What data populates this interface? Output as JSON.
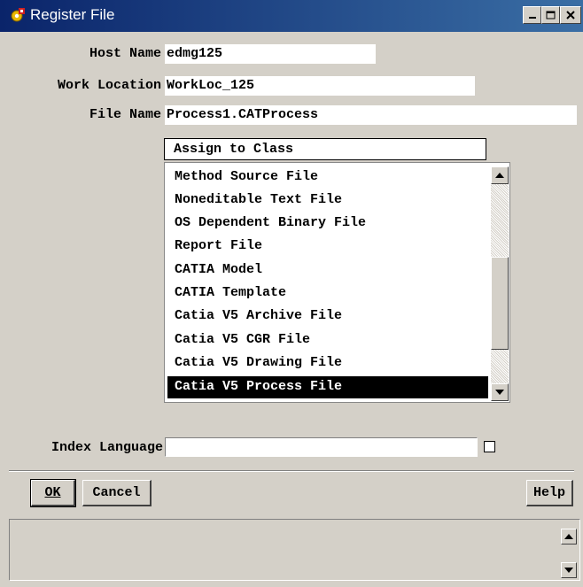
{
  "window": {
    "title": "Register File",
    "icon": "gear-app-icon",
    "controls": [
      "minimize-icon",
      "maximize-icon",
      "close-icon"
    ]
  },
  "form": {
    "host_name_label": "Host Name",
    "host_name_value": "edmg125",
    "work_location_label": "Work Location",
    "work_location_value": "WorkLoc_125",
    "file_name_label": "File Name",
    "file_name_value": "Process1.CATProcess",
    "class_header": "Assign to Class",
    "index_language_label": "Index Language",
    "index_language_value": ""
  },
  "class_list": {
    "items": [
      "Method Source File",
      "Noneditable Text File",
      "OS Dependent Binary File",
      "Report File",
      "CATIA Model",
      "CATIA Template",
      "Catia V5 Archive File",
      "Catia V5 CGR File",
      "Catia V5 Drawing File",
      "Catia V5 Process File"
    ],
    "selected": "Catia V5 Process File"
  },
  "buttons": {
    "ok": "OK",
    "cancel": "Cancel",
    "help": "Help"
  },
  "colors": {
    "window_bg": "#d4d0c8",
    "title_bar_start": "#0a246a",
    "title_bar_end": "#3a6ea5",
    "selection_bg": "#000000",
    "selection_fg": "#ffffff"
  }
}
